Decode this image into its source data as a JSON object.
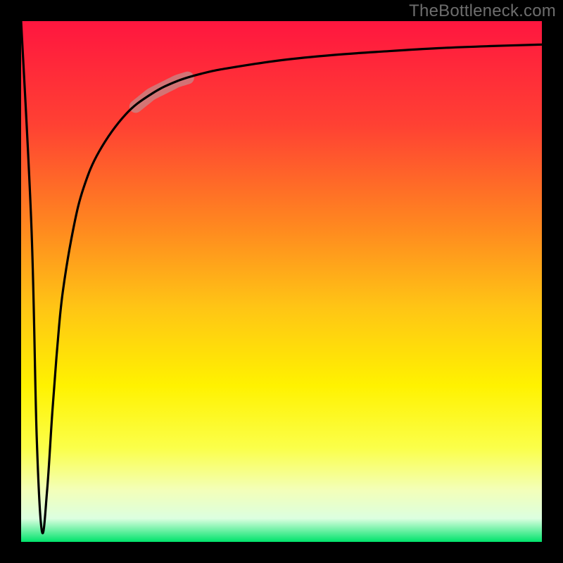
{
  "watermark": "TheBottleneck.com",
  "chart_data": {
    "type": "line",
    "title": "",
    "xlabel": "",
    "ylabel": "",
    "xlim": [
      0,
      100
    ],
    "ylim": [
      0,
      100
    ],
    "series": [
      {
        "name": "curve",
        "x": [
          0,
          2,
          3,
          4,
          5,
          6,
          7,
          8,
          10,
          12,
          15,
          20,
          25,
          30,
          35,
          40,
          50,
          60,
          70,
          80,
          90,
          100
        ],
        "y": [
          100,
          60,
          20,
          2,
          10,
          25,
          38,
          48,
          60,
          68,
          75,
          82,
          86,
          88.5,
          90,
          91,
          92.5,
          93.5,
          94.2,
          94.8,
          95.2,
          95.5
        ]
      }
    ],
    "highlight_segment": {
      "series": "curve",
      "x_start": 22,
      "x_end": 32
    },
    "gradient_stops": [
      {
        "offset": 0.0,
        "color": "#ff163f"
      },
      {
        "offset": 0.2,
        "color": "#ff4133"
      },
      {
        "offset": 0.4,
        "color": "#ff8a1f"
      },
      {
        "offset": 0.55,
        "color": "#ffc515"
      },
      {
        "offset": 0.7,
        "color": "#fff200"
      },
      {
        "offset": 0.82,
        "color": "#fbff4a"
      },
      {
        "offset": 0.9,
        "color": "#f3ffb8"
      },
      {
        "offset": 0.955,
        "color": "#dcffe0"
      },
      {
        "offset": 1.0,
        "color": "#00e36b"
      }
    ],
    "frame_thickness": 30
  }
}
